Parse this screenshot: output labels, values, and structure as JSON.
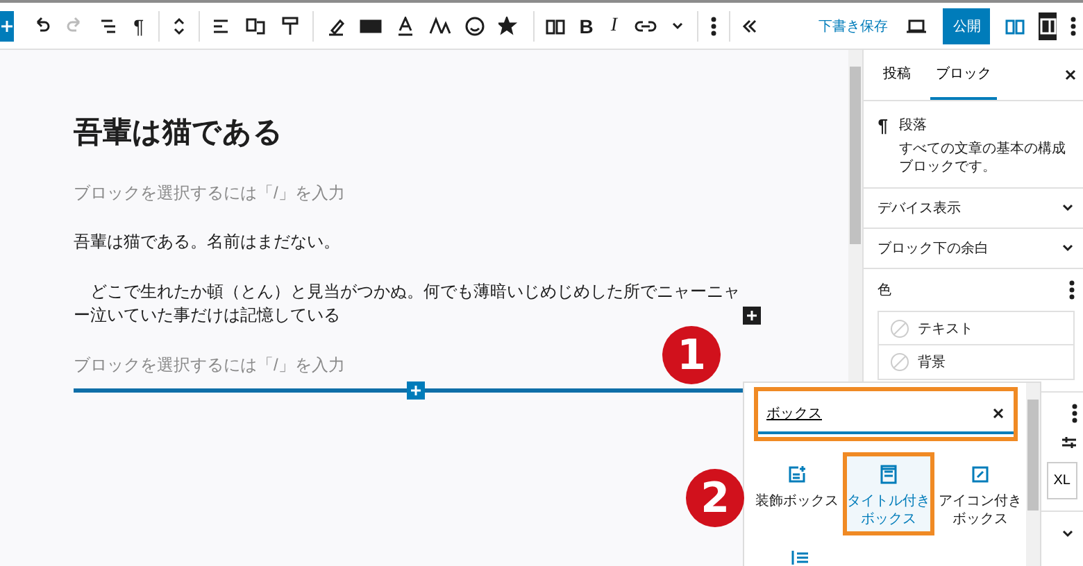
{
  "toolbar": {
    "glyphs": [
      "¶",
      "B",
      "I"
    ],
    "save_draft": "下書き保存",
    "publish": "公開"
  },
  "editor": {
    "title": "吾輩は猫である",
    "blocks": [
      {
        "kind": "placeholder",
        "text": "ブロックを選択するには「/」を入力"
      },
      {
        "kind": "paragraph",
        "text": "吾輩は猫である。名前はまだない。"
      },
      {
        "kind": "paragraph",
        "text": "　どこで生れたか頓（とん）と見当がつかぬ。何でも薄暗いじめじめした所でニャーニャー泣いていた事だけは記憶している"
      },
      {
        "kind": "placeholder",
        "text": "ブロックを選択するには「/」を入力"
      }
    ]
  },
  "annotations": [
    {
      "label": "1"
    },
    {
      "label": "2"
    }
  ],
  "inserter": {
    "search": {
      "value": "ボックス"
    },
    "results": [
      {
        "label": "装飾ボックス",
        "selected": false
      },
      {
        "label": "タイトル付きボックス",
        "selected": true
      },
      {
        "label": "アイコン付きボックス",
        "selected": false
      }
    ]
  },
  "sidebar": {
    "tabs": [
      {
        "label": "投稿",
        "selected": false
      },
      {
        "label": "ブロック",
        "selected": true
      }
    ],
    "block": {
      "name": "段落",
      "description": "すべての文章の基本の構成ブロックです。"
    },
    "panels": [
      {
        "title": "デバイス表示",
        "expanded": false
      },
      {
        "title": "ブロック下の余白",
        "expanded": false
      }
    ],
    "color_panel": {
      "title": "色",
      "items": [
        "テキスト",
        "背景"
      ]
    },
    "size_option": "XL"
  }
}
